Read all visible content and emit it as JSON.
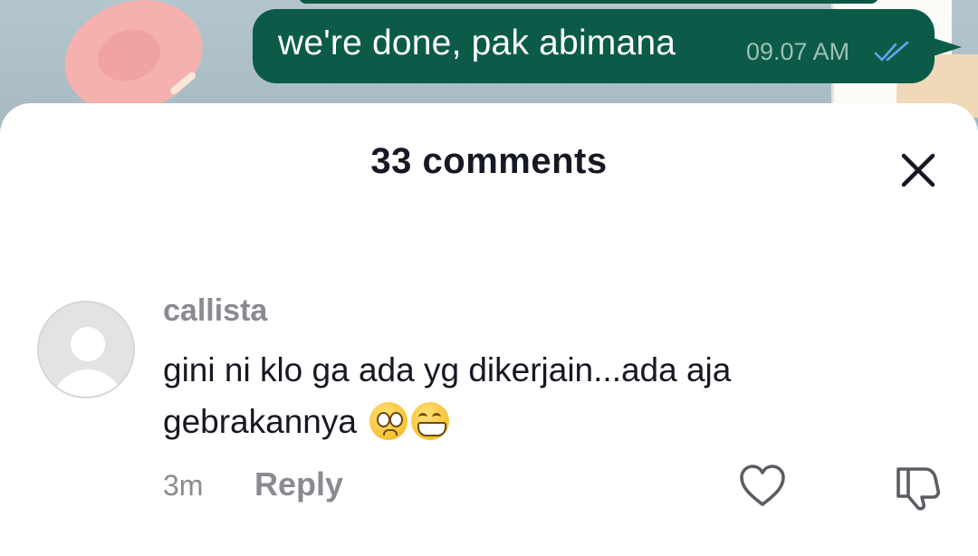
{
  "chat_bubble": {
    "message": "we're done, pak abimana",
    "time": "09.07 AM",
    "read_icon": "double-check-icon",
    "color": "#0b5b48"
  },
  "comments_sheet": {
    "title": "33 comments",
    "close_icon": "close-icon",
    "comments": [
      {
        "username": "callista",
        "text": "gini ni klo ga ada yg dikerjain...ada aja gebrakannya",
        "emojis": [
          "pleading-face-emoji",
          "grinning-face-emoji"
        ],
        "time": "3m",
        "reply_label": "Reply",
        "like_icon": "heart-icon",
        "dislike_icon": "thumbs-down-icon"
      }
    ]
  }
}
